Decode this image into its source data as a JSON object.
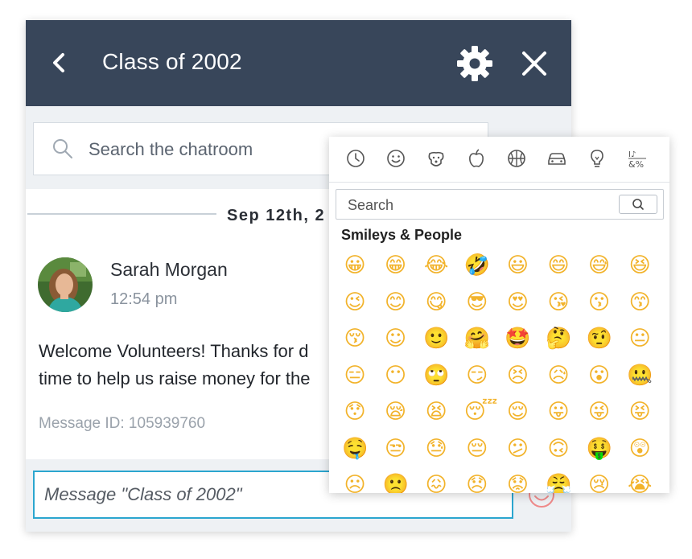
{
  "header": {
    "title": "Class of 2002"
  },
  "search": {
    "placeholder": "Search the chatroom"
  },
  "date_divider": "Sep 12th, 2",
  "message": {
    "author": "Sarah Morgan",
    "time": "12:54 pm",
    "line1": "Welcome Volunteers! Thanks for d",
    "line2": "time to help us raise money for the",
    "message_id": "Message ID: 105939760"
  },
  "compose": {
    "placeholder": "Message \"Class of 2002\""
  },
  "emoji_picker": {
    "categories": [
      "recent-icon",
      "smileys-icon",
      "animals-icon",
      "food-icon",
      "activity-icon",
      "travel-icon",
      "objects-icon",
      "symbols-icon"
    ],
    "search_placeholder": "Search",
    "section_title": "Smileys & People",
    "rows": [
      [
        "😀",
        "😁",
        "😂",
        "🤣",
        "😃",
        "😄",
        "😅",
        "😆"
      ],
      [
        "😉",
        "😊",
        "😋",
        "😎",
        "😍",
        "😘",
        "😗",
        "😙"
      ],
      [
        "😚",
        "☺",
        "🙂",
        "🤗",
        "🤩",
        "🤔",
        "🤨",
        "😐"
      ],
      [
        "😑",
        "😶",
        "🙄",
        "😏",
        "😣",
        "😥",
        "😮",
        "🤐"
      ],
      [
        "😯",
        "😪",
        "😫",
        "😴",
        "😌",
        "😛",
        "😜",
        "😝"
      ],
      [
        "🤤",
        "😒",
        "😓",
        "😔",
        "😕",
        "🙃",
        "🤑",
        "😲"
      ],
      [
        "☹",
        "🙁",
        "😖",
        "😞",
        "😟",
        "😤",
        "😢",
        "😭"
      ]
    ]
  },
  "colors": {
    "header_bg": "#38465a",
    "accent": "#2ba6cf",
    "emoji": "#f2b32b"
  }
}
